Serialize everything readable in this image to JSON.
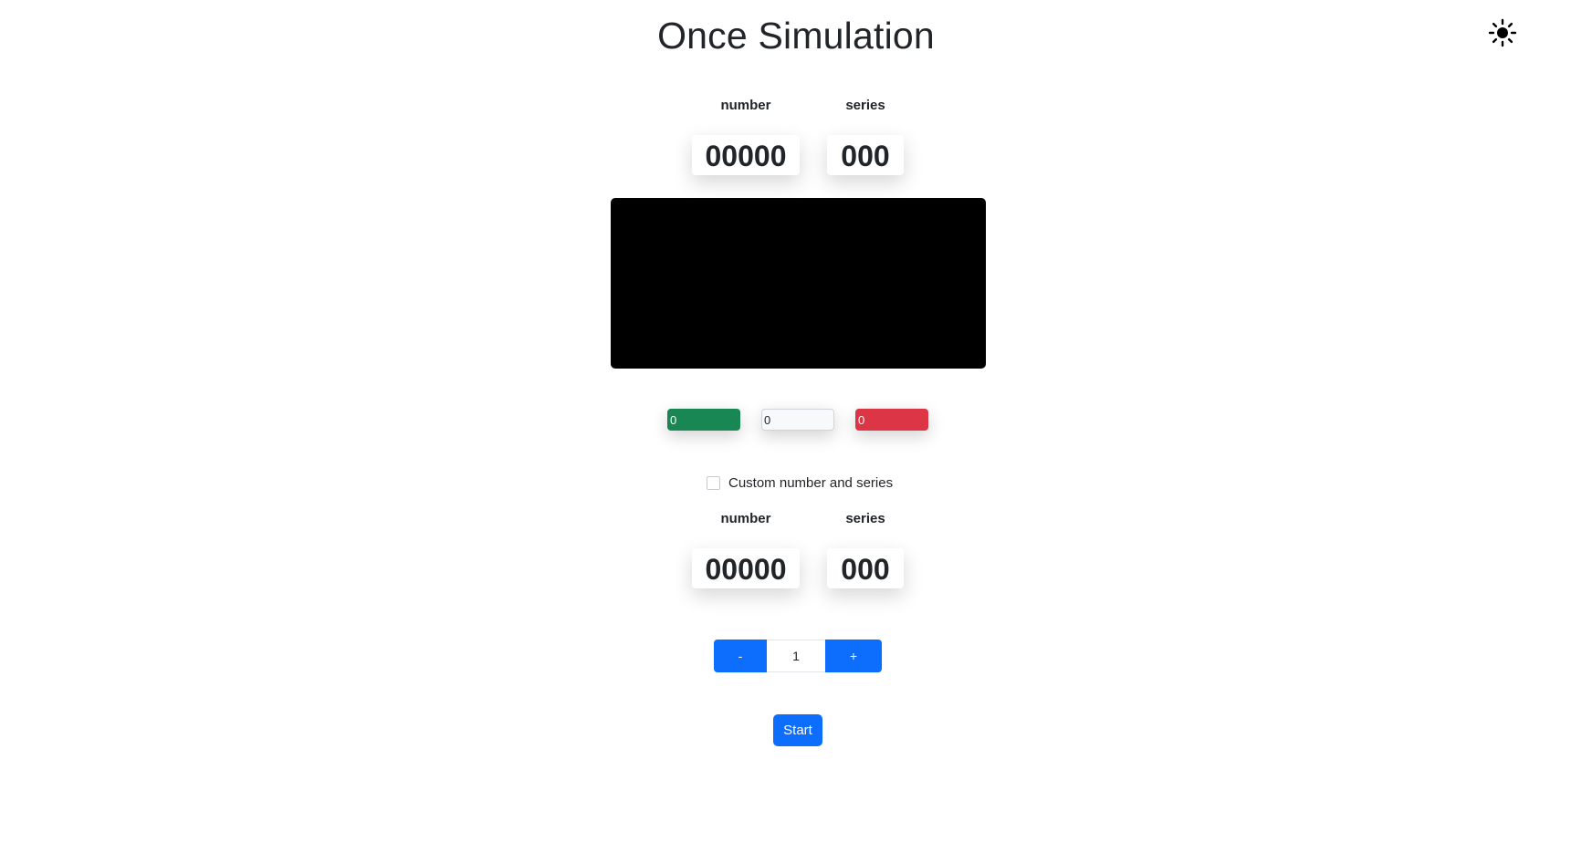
{
  "header": {
    "title": "Once Simulation",
    "theme_icon": "sun-icon"
  },
  "result_display": {
    "number_label": "number",
    "series_label": "series",
    "number_value": "00000",
    "series_value": "000"
  },
  "counters": {
    "wins": "0",
    "neutral": "0",
    "losses": "0",
    "colors": {
      "wins": "#198754",
      "neutral": "#f8f9fa",
      "losses": "#dc3545"
    }
  },
  "custom": {
    "checkbox_label": "Custom number and series",
    "checked": false,
    "number_label": "number",
    "series_label": "series",
    "number_value": "00000",
    "series_value": "000"
  },
  "stepper": {
    "minus_label": "-",
    "value": "1",
    "plus_label": "+"
  },
  "actions": {
    "start_label": "Start",
    "accent_color": "#0d6efd"
  }
}
